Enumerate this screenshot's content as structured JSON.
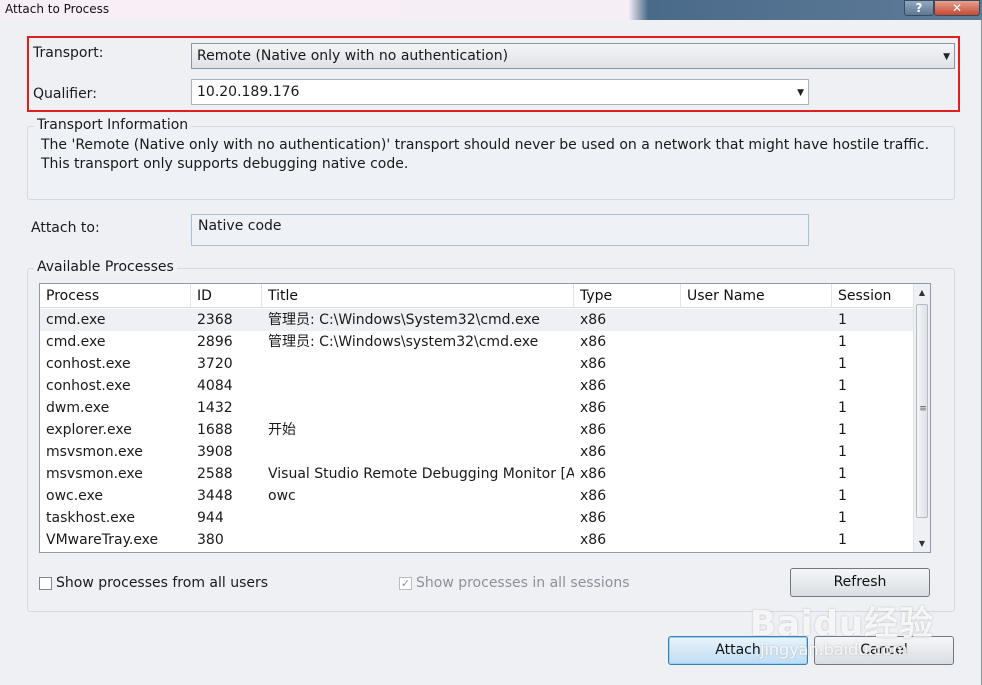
{
  "window": {
    "title": "Attach to Process",
    "help_glyph": "?",
    "close_glyph": "✕"
  },
  "transport": {
    "label": "Transport:",
    "value": "Remote (Native only with no authentication)"
  },
  "qualifier": {
    "label": "Qualifier:",
    "value": "10.20.189.176"
  },
  "transport_info": {
    "title": "Transport Information",
    "text": "The 'Remote (Native only with no authentication)' transport should never be used on a network that might have hostile traffic. This transport only supports debugging native code."
  },
  "attach_to": {
    "label": "Attach to:",
    "value": "Native code"
  },
  "available_processes": {
    "title": "Available Processes",
    "columns": {
      "process": "Process",
      "id": "ID",
      "title": "Title",
      "type": "Type",
      "user_name": "User Name",
      "session": "Session"
    },
    "rows": [
      {
        "process": "cmd.exe",
        "id": "2368",
        "title": "管理员: C:\\Windows\\System32\\cmd.exe",
        "type": "x86",
        "user_name": "",
        "session": "1"
      },
      {
        "process": "cmd.exe",
        "id": "2896",
        "title": "管理员: C:\\Windows\\system32\\cmd.exe",
        "type": "x86",
        "user_name": "",
        "session": "1"
      },
      {
        "process": "conhost.exe",
        "id": "3720",
        "title": "",
        "type": "x86",
        "user_name": "",
        "session": "1"
      },
      {
        "process": "conhost.exe",
        "id": "4084",
        "title": "",
        "type": "x86",
        "user_name": "",
        "session": "1"
      },
      {
        "process": "dwm.exe",
        "id": "1432",
        "title": "",
        "type": "x86",
        "user_name": "",
        "session": "1"
      },
      {
        "process": "explorer.exe",
        "id": "1688",
        "title": "开始",
        "type": "x86",
        "user_name": "",
        "session": "1"
      },
      {
        "process": "msvsmon.exe",
        "id": "3908",
        "title": "",
        "type": "x86",
        "user_name": "",
        "session": "1"
      },
      {
        "process": "msvsmon.exe",
        "id": "2588",
        "title": "Visual Studio Remote Debugging Monitor [A...",
        "type": "x86",
        "user_name": "",
        "session": "1"
      },
      {
        "process": "owc.exe",
        "id": "3448",
        "title": "owc",
        "type": "x86",
        "user_name": "",
        "session": "1"
      },
      {
        "process": "taskhost.exe",
        "id": "944",
        "title": "",
        "type": "x86",
        "user_name": "",
        "session": "1"
      },
      {
        "process": "VMwareTray.exe",
        "id": "380",
        "title": "",
        "type": "x86",
        "user_name": "",
        "session": "1"
      }
    ]
  },
  "options": {
    "show_all_users": {
      "label": "Show processes from all users",
      "checked": false
    },
    "show_all_sessions": {
      "label": "Show processes in all sessions",
      "checked": true,
      "disabled": true
    }
  },
  "buttons": {
    "refresh": "Refresh",
    "attach": "Attach",
    "cancel": "Cancel"
  },
  "watermark": {
    "brand": "Baidu经验",
    "url": "jingyan.baidu.com"
  },
  "colors": {
    "highlight_border": "#e02020",
    "accent": "#3c7fb1"
  }
}
